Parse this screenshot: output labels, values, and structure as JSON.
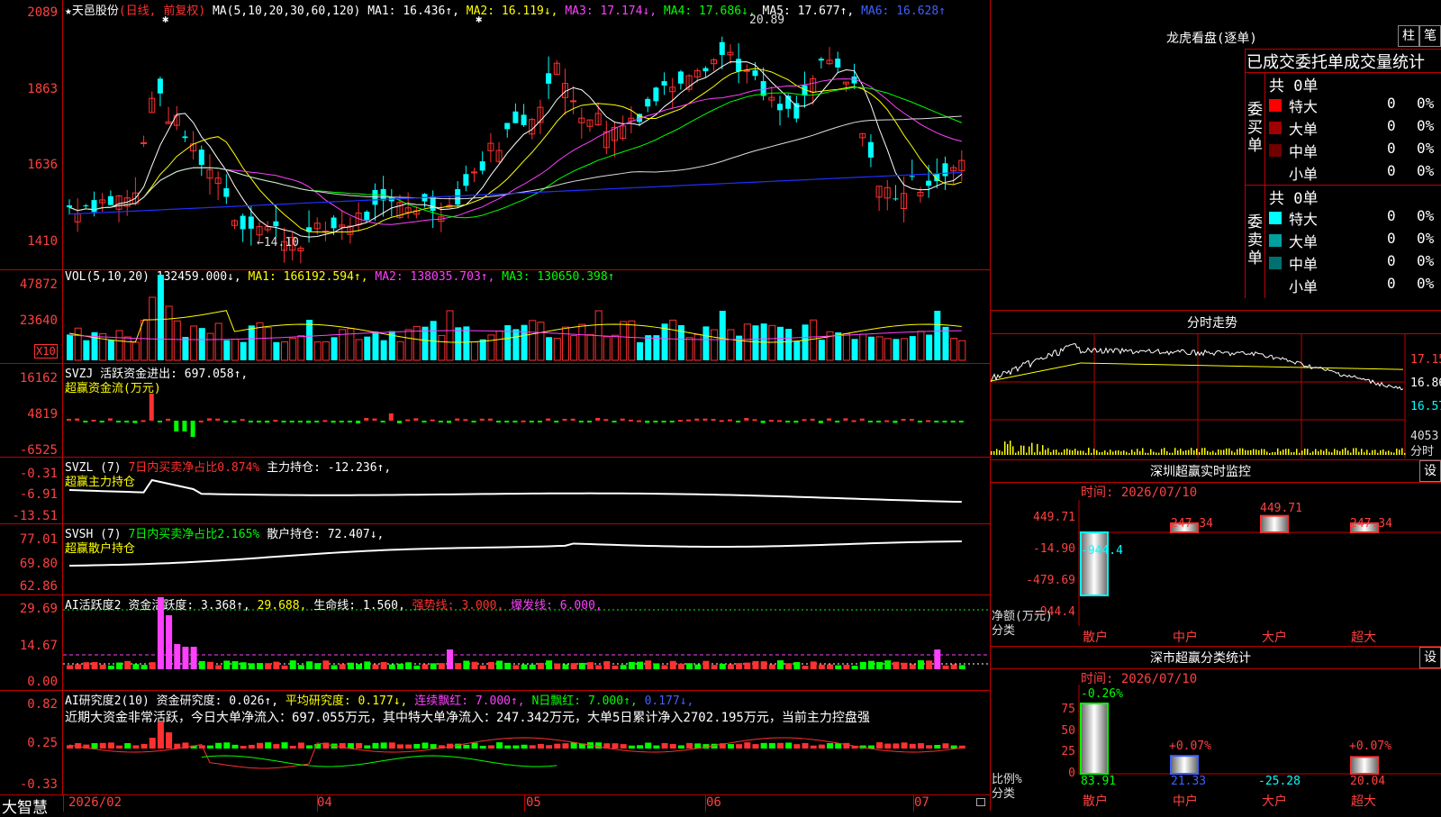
{
  "main_chart": {
    "header": {
      "star": "★",
      "name": "天邑股份",
      "period": "(日线, 前复权)",
      "ma_label": "MA(5,10,20,30,60,120)",
      "ma1": "MA1: 16.436↑,",
      "ma2": "MA2: 16.119↓,",
      "ma3": "MA3: 17.174↓,",
      "ma4": "MA4: 17.686↓,",
      "ma5": "MA5: 17.677↑,",
      "ma6": "MA6: 16.628↑"
    },
    "y_labels": [
      "2089",
      "1863",
      "1636",
      "1410"
    ],
    "high_label": "20.89",
    "low_label": "←14.10",
    "star_marks": [
      "✱",
      "✱"
    ]
  },
  "vol_chart": {
    "header": {
      "label": "VOL(5,10,20)",
      "vol": "132459.000↓,",
      "ma1": "MA1: 166192.594↑,",
      "ma2": "MA2: 138035.703↑,",
      "ma3": "MA3: 130650.398↑"
    },
    "y_labels": [
      "47872",
      "23640"
    ],
    "unit_box": "X10"
  },
  "svzj_chart": {
    "header": {
      "label": "SVZJ",
      "text": "活跃资金进出: 697.058↑,",
      "sub": "超赢资金流(万元)"
    },
    "y_labels": [
      "16162",
      "4819",
      "-6525"
    ]
  },
  "svzl_chart": {
    "header": {
      "label": "SVZL (7)",
      "ratio": "7日内买卖净占比0.874%",
      "text": "主力持仓: -12.236↑,",
      "sub": "超赢主力持仓"
    },
    "y_labels": [
      "-0.31",
      "-6.91",
      "-13.51"
    ]
  },
  "svsh_chart": {
    "header": {
      "label": "SVSH (7)",
      "ratio": "7日内买卖净占比2.165%",
      "text": "散户持仓: 72.407↓,",
      "sub": "超赢散户持仓"
    },
    "y_labels": [
      "77.01",
      "69.80",
      "62.86"
    ]
  },
  "ai_active": {
    "header": {
      "label": "AI活跃度2",
      "text": "资金活跃度: 3.368↑,",
      "v2": "29.688,",
      "life": "生命线: 1.560,",
      "strong": "强势线: 3.000,",
      "burst": "爆发线: 6.000,"
    },
    "y_labels": [
      "29.69",
      "14.67",
      "0.00"
    ]
  },
  "ai_research": {
    "header": {
      "label": "AI研究度2(10)",
      "text": "资金研究度: 0.026↑,",
      "avg": "平均研究度: 0.177↓,",
      "lianxu": "连续飘红: 7.000↑,",
      "nri": "N日飘红: 7.000↑,",
      "last": "0.177↓,"
    },
    "comment": "近期大资金非常活跃，今日大单净流入：697.055万元，其中特大单净流入：247.342万元，大单5日累计净入2702.195万元，当前主力控盘强",
    "y_labels": [
      "0.82",
      "0.25",
      "-0.33"
    ]
  },
  "x_axis": {
    "labels": [
      "2026/02",
      "04",
      "05",
      "06",
      "07"
    ],
    "brand": "大智慧"
  },
  "longhu": {
    "title": "龙虎看盘(逐单)",
    "btn_zhu": "柱",
    "btn_bi": "笔",
    "subtitle": "已成交委托单成交量统计",
    "buy_side": "委买单",
    "sell_side": "委卖单",
    "buy_total": "共 0单",
    "sell_total": "共 0单",
    "rows_buy": [
      {
        "label": "特大",
        "val": "0",
        "pct": "0%",
        "color": "#ff0000"
      },
      {
        "label": "大单",
        "val": "0",
        "pct": "0%",
        "color": "#a00000"
      },
      {
        "label": "中单",
        "val": "0",
        "pct": "0%",
        "color": "#700000"
      },
      {
        "label": "小单",
        "val": "0",
        "pct": "0%",
        "color": ""
      }
    ],
    "rows_sell": [
      {
        "label": "特大",
        "val": "0",
        "pct": "0%",
        "color": "#00ffff"
      },
      {
        "label": "大单",
        "val": "0",
        "pct": "0%",
        "color": "#00a0a0"
      },
      {
        "label": "中单",
        "val": "0",
        "pct": "0%",
        "color": "#007070"
      },
      {
        "label": "小单",
        "val": "0",
        "pct": "0%",
        "color": ""
      }
    ]
  },
  "intraday": {
    "title": "分时走势",
    "y_labels": [
      "17.15",
      "16.86",
      "16.57"
    ],
    "vol_label": "4053",
    "vol_unit": "分时"
  },
  "sz_monitor": {
    "title": "深圳超赢实时监控",
    "btn": "设",
    "date": "时间: 2026/07/10",
    "y_labels": [
      "449.71",
      "-14.90",
      "-479.69",
      "-944.4"
    ],
    "y_unit": "净额(万元)",
    "cat_unit": "分类",
    "bars": [
      {
        "cat": "散户",
        "val_label": "-944.4",
        "value": -944.4
      },
      {
        "cat": "中户",
        "val_label": "247.34",
        "value": 247.34
      },
      {
        "cat": "大户",
        "val_label": "449.71",
        "value": 449.71
      },
      {
        "cat": "超大",
        "val_label": "247.34",
        "value": 247.34
      }
    ]
  },
  "sz_class": {
    "title": "深市超赢分类统计",
    "btn": "设",
    "date": "时间: 2026/07/10",
    "y_labels": [
      "75",
      "50",
      "25",
      "0"
    ],
    "y_unit": "比例%",
    "cat_unit": "分类",
    "bars": [
      {
        "cat": "散户",
        "top_label": "-0.26%",
        "bottom_label": "83.91",
        "value": 83.91
      },
      {
        "cat": "中户",
        "top_label": "+0.07%",
        "bottom_label": "21.33",
        "value": 21.33
      },
      {
        "cat": "大户",
        "top_label": "",
        "bottom_label": "-25.28",
        "value": 0
      },
      {
        "cat": "超大",
        "top_label": "+0.07%",
        "bottom_label": "20.04",
        "value": 20.04
      }
    ]
  }
}
